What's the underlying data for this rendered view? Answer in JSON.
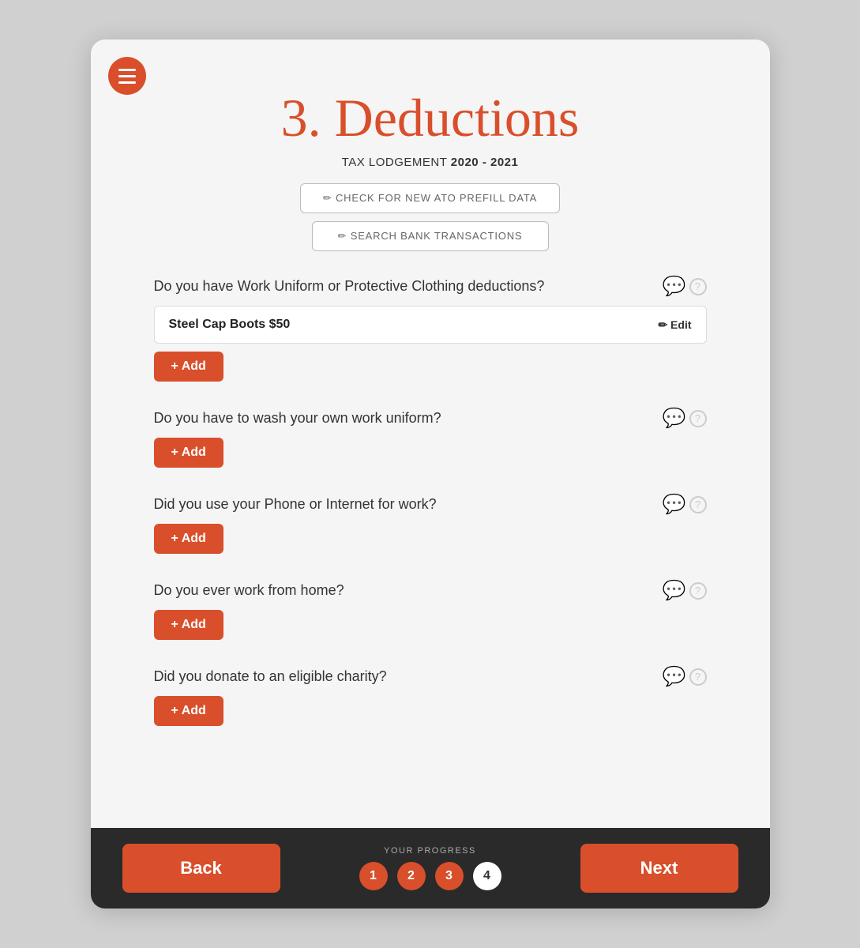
{
  "page": {
    "title": "3. Deductions",
    "subtitle_normal": "TAX LODGEMENT ",
    "subtitle_bold": "2020 - 2021"
  },
  "actions": {
    "check_ato_label": "✏ CHECK FOR NEW ATO PREFILL DATA",
    "search_bank_label": "✏ SEARCH BANK TRANSACTIONS"
  },
  "sections": [
    {
      "id": "uniform",
      "question": "Do you have Work Uniform or Protective Clothing deductions?",
      "items": [
        {
          "label": "Steel Cap Boots $50",
          "edit_label": "✏ Edit"
        }
      ],
      "add_label": "+ Add"
    },
    {
      "id": "wash",
      "question": "Do you have to wash your own work uniform?",
      "items": [],
      "add_label": "+ Add"
    },
    {
      "id": "phone",
      "question": "Did you use your Phone or Internet for work?",
      "items": [],
      "add_label": "+ Add"
    },
    {
      "id": "home",
      "question": "Do you ever work from home?",
      "items": [],
      "add_label": "+ Add"
    },
    {
      "id": "charity",
      "question": "Did you donate to an eligible charity?",
      "items": [],
      "add_label": "+ Add"
    }
  ],
  "footer": {
    "progress_label": "YOUR PROGRESS",
    "steps": [
      {
        "number": "1",
        "state": "active"
      },
      {
        "number": "2",
        "state": "active"
      },
      {
        "number": "3",
        "state": "active"
      },
      {
        "number": "4",
        "state": "current"
      }
    ],
    "back_label": "Back",
    "next_label": "Next"
  }
}
